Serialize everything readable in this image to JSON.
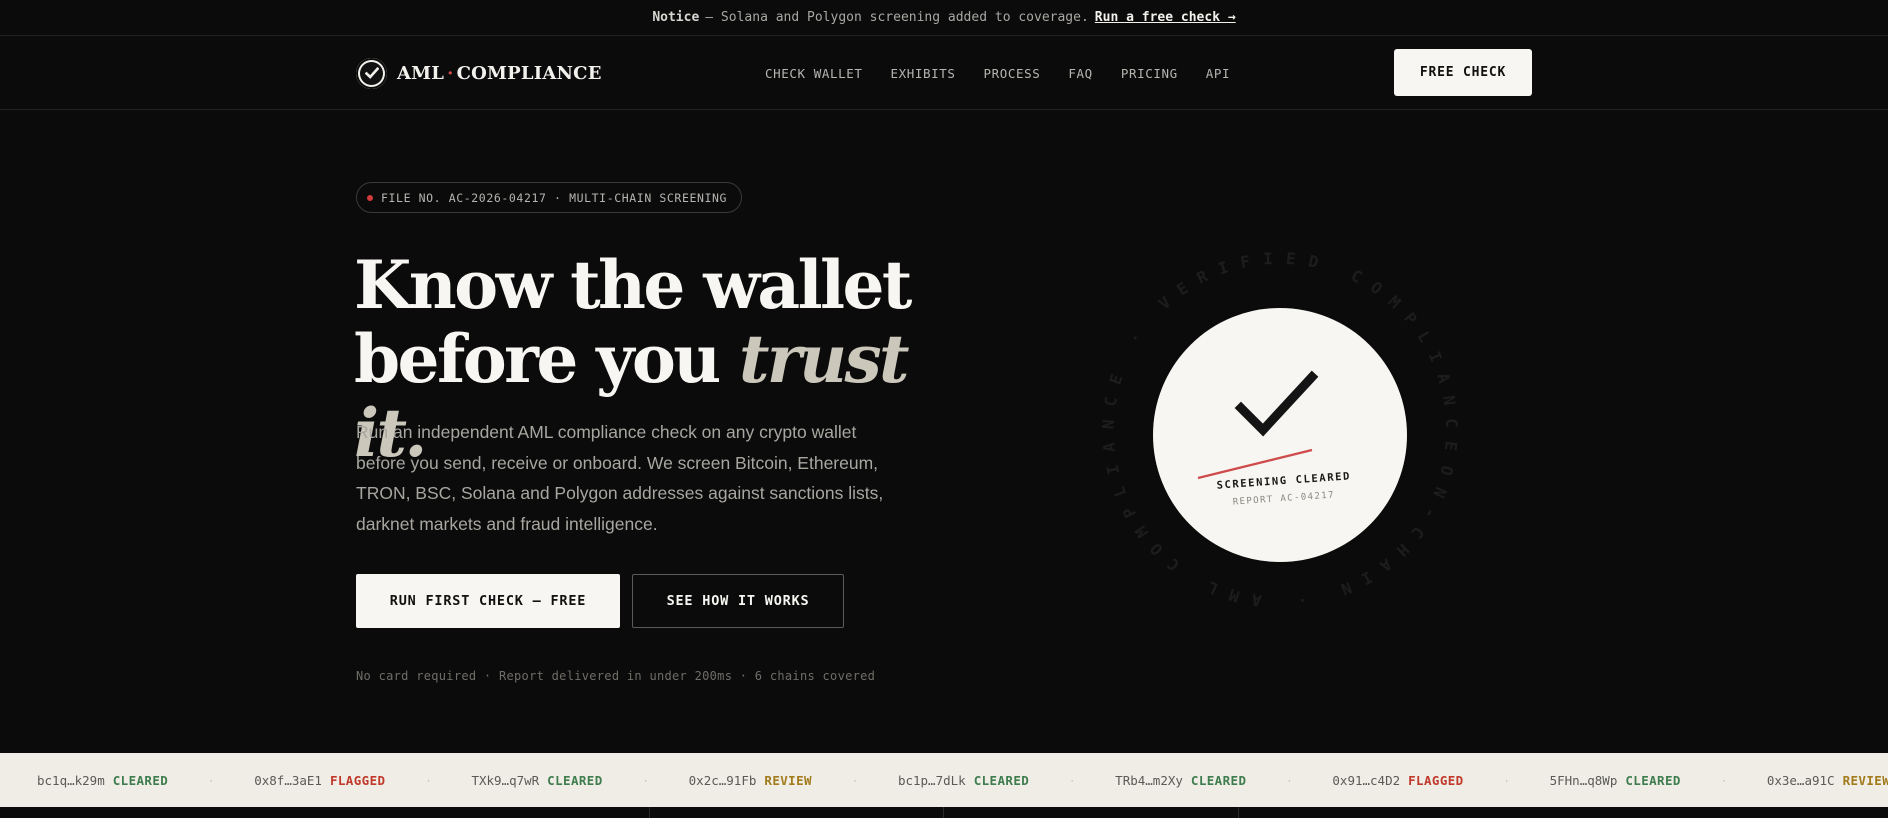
{
  "notice": {
    "label": "Notice",
    "text": "— Solana and Polygon screening added to coverage.",
    "link": "Run a free check →"
  },
  "nav": {
    "brand_left": "AML",
    "brand_right": "COMPLIANCE",
    "links": [
      "CHECK WALLET",
      "EXHIBITS",
      "PROCESS",
      "FAQ",
      "PRICING",
      "API"
    ],
    "cta": "FREE CHECK"
  },
  "hero": {
    "file_tag": "FILE NO. AC-2026-04217 · MULTI-CHAIN SCREENING",
    "headline_line1": "Know the wallet",
    "headline_line2_plain": "before you ",
    "headline_line2_italic": "trust it.",
    "lede": "Run an independent AML compliance check on any crypto wallet before you send, receive or onboard. We screen Bitcoin, Ethereum, TRON, BSC, Solana and Polygon addresses against sanctions lists, darknet markets and fraud intelligence.",
    "cta_primary": "RUN FIRST CHECK — FREE",
    "cta_secondary": "SEE HOW IT WORKS",
    "footnote": "No card required · Report delivered in under 200ms · 6 chains covered"
  },
  "seal": {
    "ring_text": "ON-CHAIN · AML COMPLIANCE · VERIFIED COMPLIANCE · VERIFIED ·",
    "status": "SCREENING CLEARED",
    "report": "REPORT AC-04217"
  },
  "ticker": [
    {
      "address": "bc1q…k29m",
      "status": "CLEARED"
    },
    {
      "address": "0x8f…3aE1",
      "status": "FLAGGED"
    },
    {
      "address": "TXk9…q7wR",
      "status": "CLEARED"
    },
    {
      "address": "0x2c…91Fb",
      "status": "REVIEW"
    },
    {
      "address": "bc1p…7dLk",
      "status": "CLEARED"
    },
    {
      "address": "TRb4…m2Xy",
      "status": "CLEARED"
    },
    {
      "address": "0x91…c4D2",
      "status": "FLAGGED"
    },
    {
      "address": "5FHn…q8Wp",
      "status": "CLEARED"
    },
    {
      "address": "0x3e…a91C",
      "status": "REVIEW"
    }
  ],
  "colors": {
    "background": "#0b0b0b",
    "accent_red": "#d14a4a",
    "cleared": "#3f7d4f",
    "flagged": "#c0392b",
    "review": "#a27b1c",
    "paper": "#f7f6f2"
  }
}
